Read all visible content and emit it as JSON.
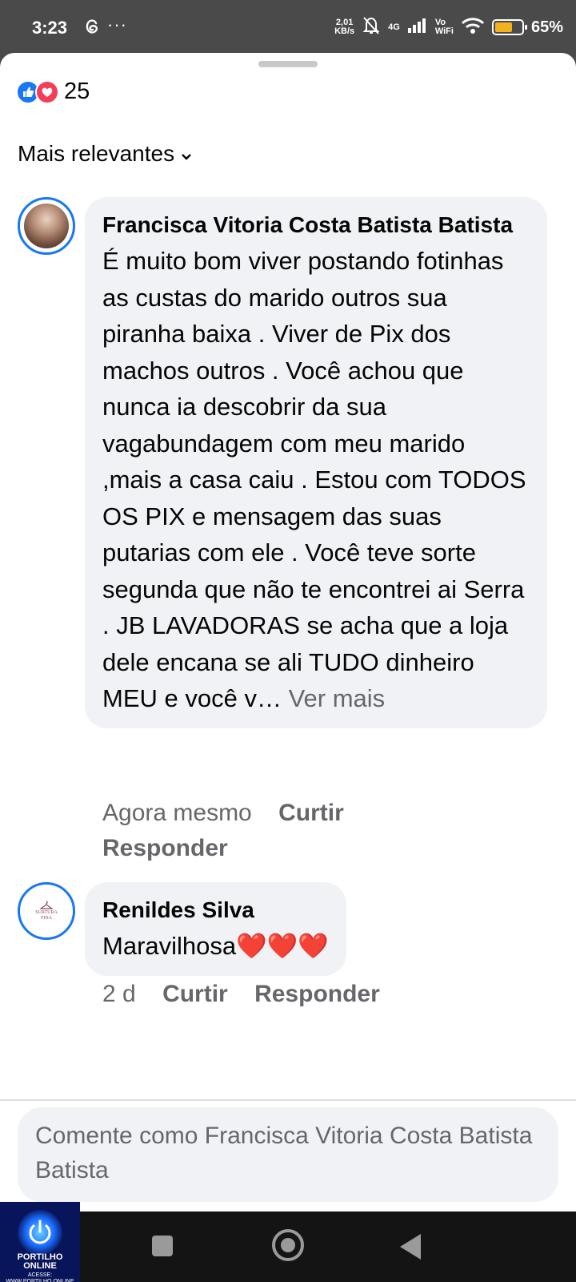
{
  "status_bar": {
    "time": "3:23",
    "threads_icon": "threads-icon",
    "more": "···",
    "speed_value": "2,01",
    "speed_unit": "KB/s",
    "network": "4G",
    "vowifi_top": "Vo",
    "vowifi_bottom": "WiFi",
    "battery_percent": "65%",
    "battery_level": 0.65,
    "battery_color": "#f2b21c"
  },
  "reactions": {
    "count": "25",
    "types": [
      "like-icon",
      "love-icon"
    ]
  },
  "sort": {
    "label": "Mais relevantes"
  },
  "comments": [
    {
      "author": "Francisca Vitoria Costa Batista Batista",
      "text": "É muito bom viver postando fotinhas as custas do marido outros sua piranha baixa . Viver de Pix dos machos outros . Você achou que nunca ia descobrir da sua vagabundagem com meu marido ,mais a casa caiu . Estou com TODOS OS PIX e mensagem das suas putarias com ele . Você teve sorte segunda que não te encontrei ai Serra . JB LAVADORAS se acha que a loja dele encana se ali TUDO dinheiro MEU e você v…",
      "see_more": "Ver mais",
      "time": "Agora mesmo",
      "like": "Curtir",
      "reply": "Responder"
    },
    {
      "author": "Renildes Silva",
      "text": "Maravilhosa❤️❤️❤️",
      "time": "2 d",
      "like": "Curtir",
      "reply": "Responder",
      "avatar_logo_top": "SURTURA",
      "avatar_logo_bottom": "FINA"
    }
  ],
  "composer": {
    "placeholder": "Comente como Francisca Vitoria Costa Batista Batista"
  },
  "watermark": {
    "line1": "PORTILHO",
    "line2": "ONLINE",
    "line3": "ACESSE: WWW.PORTILHO.ONLINE"
  },
  "colors": {
    "accent": "#1877f2",
    "love": "#f33e58",
    "bubble": "#f0f2f5",
    "secondary_text": "#65676b"
  }
}
